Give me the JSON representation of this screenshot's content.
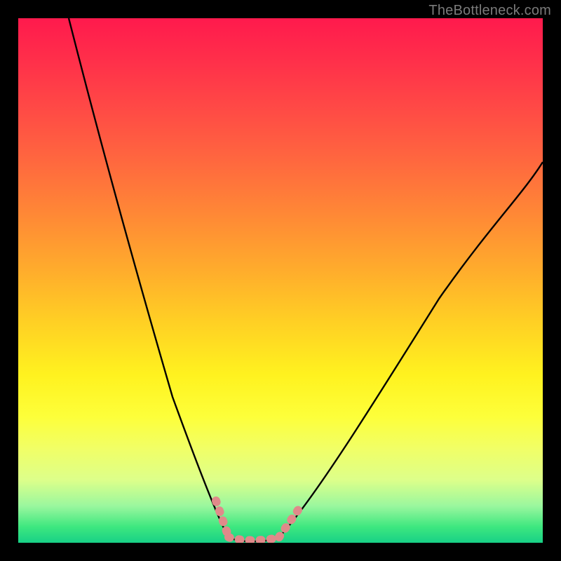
{
  "watermark": {
    "text": "TheBottleneck.com"
  },
  "colors": {
    "background": "#000000",
    "curve_stroke": "#000000",
    "marker_stroke": "#e08a8a",
    "gradient_top": "#ff1a4d",
    "gradient_bottom": "#18d186"
  },
  "chart_data": {
    "type": "line",
    "title": "",
    "xlabel": "",
    "ylabel": "",
    "xlim": [
      0,
      100
    ],
    "ylim": [
      0,
      100
    ],
    "grid": false,
    "legend": false,
    "note": "Bottleneck curve: y ≈ 0 (green) is optimal, y → 100 (red) is severe bottleneck. Two curves descend from top edges and meet at a flat minimum near x ≈ 40–50.",
    "series": [
      {
        "name": "left-curve",
        "x": [
          10,
          14,
          18,
          22,
          26,
          30,
          34,
          38,
          40
        ],
        "y": [
          100,
          86,
          72,
          58,
          44,
          31,
          19,
          8,
          3
        ]
      },
      {
        "name": "flat-minimum",
        "x": [
          40,
          42,
          44,
          46,
          48,
          50
        ],
        "y": [
          3,
          1,
          0.5,
          0.5,
          1,
          3
        ]
      },
      {
        "name": "right-curve",
        "x": [
          50,
          56,
          62,
          68,
          74,
          80,
          86,
          92,
          98,
          100
        ],
        "y": [
          3,
          9,
          17,
          26,
          35,
          44,
          53,
          62,
          70,
          73
        ]
      }
    ],
    "markers": [
      {
        "name": "left-marker-segment",
        "x": [
          38,
          40,
          42
        ],
        "y": [
          8,
          3,
          1
        ]
      },
      {
        "name": "bottom-marker-segment",
        "x": [
          42,
          44,
          46,
          48
        ],
        "y": [
          1,
          0.5,
          0.5,
          1
        ]
      },
      {
        "name": "right-marker-segment",
        "x": [
          48,
          50,
          52
        ],
        "y": [
          1,
          3,
          6
        ]
      }
    ]
  }
}
